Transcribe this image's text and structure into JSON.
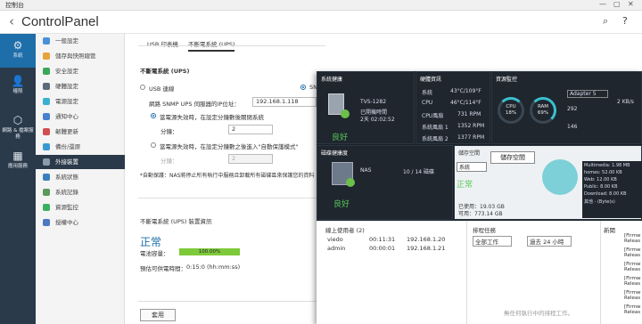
{
  "window": {
    "title": "控制台",
    "minimize": "—",
    "maximize": "▢",
    "close": "✕"
  },
  "header": {
    "back": "‹",
    "app_name": "ControlPanel",
    "icons": [
      "search-icon",
      "help-icon"
    ]
  },
  "leftnav": [
    {
      "label": "系統",
      "icon": "gear-icon"
    },
    {
      "label": "權限",
      "icon": "user-icon"
    },
    {
      "label": "網路 & 檔案服務",
      "icon": "network-icon"
    },
    {
      "label": "應用服務",
      "icon": "apps-icon"
    }
  ],
  "subnav": [
    "一般設定",
    "儲存與快照總管",
    "安全設定",
    "硬體設定",
    "電源設定",
    "通知中心",
    "韌體更新",
    "備份/還原",
    "外接裝置",
    "系統狀態",
    "系統記錄",
    "資源監控",
    "授權中心"
  ],
  "tabs": [
    "USB 印表機",
    "不斷電系統 (UPS)"
  ],
  "ups": {
    "section_title": "不斷電系統 (UPS)",
    "usb_label": "USB 連線",
    "snmp_label": "SNMP",
    "snmp_ip_label": "網路 SNMP UPS 伺服器的IP位址：",
    "snmp_ip_value": "192.168.1.118",
    "opt1_label": "當電源失效時，在設定分鐘數後關閉系統",
    "min1_label": "分鐘：",
    "min1_value": "2",
    "opt2_label": "當電源失效時，在設定分鐘數之後進入\"自動保護模式\"",
    "min2_label": "分鐘：",
    "min2_value": "2",
    "note": "*自動保護：NAS將停止所有執行中服務且卸載所有磁碟區來保護您的資料",
    "info_title": "不斷電系統 (UPS) 裝置資訊",
    "status": "正常",
    "battery_label": "電池容量：",
    "battery_value": "100.00%",
    "battery_fraction": 1.0,
    "runtime_label": "預估可供電時間：",
    "runtime_value": "0:15:0 (hh:mm:ss)",
    "apply": "套用"
  },
  "dash": {
    "sys_title": "系統健康",
    "model": "TVS-1282",
    "uptime_label": "已開機時間",
    "uptime_value": "2天 02:02:52",
    "health": "良好",
    "hw_title": "硬體資訊",
    "hw": [
      {
        "k": "系統",
        "v": "43°C/109°F"
      },
      {
        "k": "CPU",
        "v": "46°C/114°F"
      },
      {
        "k": "CPU風扇",
        "v": "731 RPM"
      },
      {
        "k": "系統風扇 1",
        "v": "1352 RPM"
      },
      {
        "k": "系統風扇 2",
        "v": "1377 RPM"
      }
    ],
    "res_title": "資源監控",
    "cpu_label": "CPU",
    "cpu_value": "18%",
    "cpu_fraction": 0.18,
    "ram_label": "RAM",
    "ram_value": "69%",
    "ram_fraction": 0.69,
    "adapter": "Adapter 5",
    "net_a": "292",
    "net_b": "146",
    "net_rate": "2 KB/s",
    "disk_title": "磁碟健康度",
    "nas_label": "NAS",
    "disk_count": "10 / 14 磁碟",
    "disk_health": "良好",
    "storage_title": "儲存空間",
    "storage_select": "系統",
    "storage_status": "正常",
    "used_label": "已使用：19.03 GB",
    "free_label": "可用：773.14 GB",
    "tooltip": "儲存空間",
    "legend": [
      "Multimedia: 1.98 MB",
      "homes: 52.00 KB",
      "Web: 12.00 KB",
      "Public: 8.00 KB",
      "Download: 8.00 KB",
      "其他 - (Byte(s)"
    ],
    "online_title": "線上使用者 (2)",
    "users": [
      {
        "name": "viedo",
        "time": "00:11:31",
        "ip": "192.168.1.20"
      },
      {
        "name": "admin",
        "time": "00:00:01",
        "ip": "192.168.1.21"
      }
    ],
    "tasks_title": "排程任務",
    "task_sel1": "全部工作",
    "task_sel2": "過去 24 小時",
    "no_task": "無任何執行中的排程工作。",
    "news_title": "新聞",
    "news": [
      "[Firmw Releas",
      "[Firmw Releas",
      "[Firmw Releas",
      "[Firmw Releas",
      "[Firmw Releas",
      "[Firmw Releas"
    ]
  }
}
